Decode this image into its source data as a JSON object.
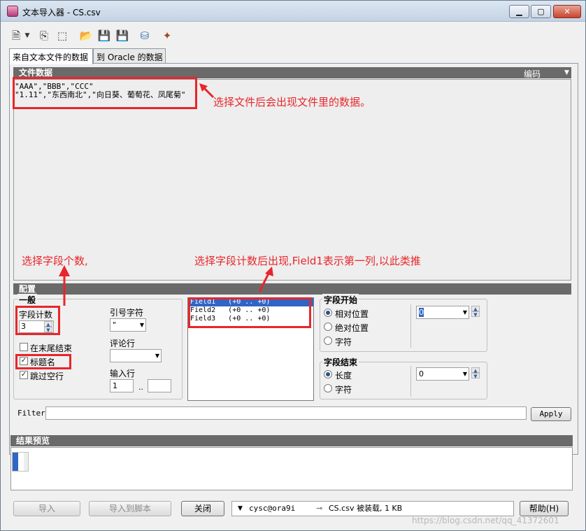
{
  "window": {
    "title": "文本导入器 - CS.csv",
    "minimize": "▁",
    "maximize": "▢",
    "close": "✕"
  },
  "toolbar": {
    "icons": [
      "new-file-icon",
      "dropdown-arrow-icon",
      "copy-icon",
      "select-icon",
      "open-folder-icon",
      "save-disabled-icon",
      "save-icon",
      "database-icon",
      "wand-icon"
    ]
  },
  "tabs": [
    {
      "label": "来自文本文件的数据",
      "active": true
    },
    {
      "label": "到 Oracle 的数据",
      "active": false
    }
  ],
  "file_data": {
    "header": "文件数据",
    "encoding_label": "编码",
    "lines": [
      "\"AAA\",\"BBB\",\"CCC\"",
      "\"1.11\",\"东西南北\",\"向日葵、葡萄花、凤尾菊\""
    ]
  },
  "config": {
    "header": "配置",
    "general": {
      "title": "一般",
      "field_count_label": "字段计数",
      "field_count_value": "3",
      "quote_char_label": "引号字符",
      "quote_char_value": "\"",
      "comment_row_label": "评论行",
      "comment_row_value": "",
      "input_row_label": "输入行",
      "input_row_from": "1",
      "input_row_sep": "..",
      "input_row_to": "",
      "end_at_tail_label": "在末尾结束",
      "end_at_tail_checked": false,
      "title_name_label": "标题名",
      "title_name_checked": true,
      "skip_blank_label": "跳过空行",
      "skip_blank_checked": true
    },
    "fields": [
      {
        "text": "Field1   (+0 .. +0)",
        "selected": true
      },
      {
        "text": "Field2   (+0 .. +0)",
        "selected": false
      },
      {
        "text": "Field3   (+0 .. +0)",
        "selected": false
      }
    ],
    "field_start": {
      "title": "字段开始",
      "options": [
        "相对位置",
        "绝对位置",
        "字符"
      ],
      "selected": 0,
      "value": "0"
    },
    "field_end": {
      "title": "字段结束",
      "options": [
        "长度",
        "字符"
      ],
      "selected": 0,
      "value": "0"
    }
  },
  "filter": {
    "label": "Filter",
    "value": "",
    "apply": "Apply"
  },
  "preview": {
    "header": "结果预览"
  },
  "bottom": {
    "import": "导入",
    "import_script": "导入到脚本",
    "close": "关闭",
    "connection": "cysc@ora9i",
    "status": "CS.csv 被装载, 1 KB",
    "help": "帮助(H)"
  },
  "annotations": {
    "file_note": "选择文件后会出现文件里的数据。",
    "field_count_note": "选择字段个数,",
    "field_list_note": "选择字段计数后出现,Field1表示第一列,以此类推"
  },
  "watermark": "https://blog.csdn.net/qq_41372601"
}
